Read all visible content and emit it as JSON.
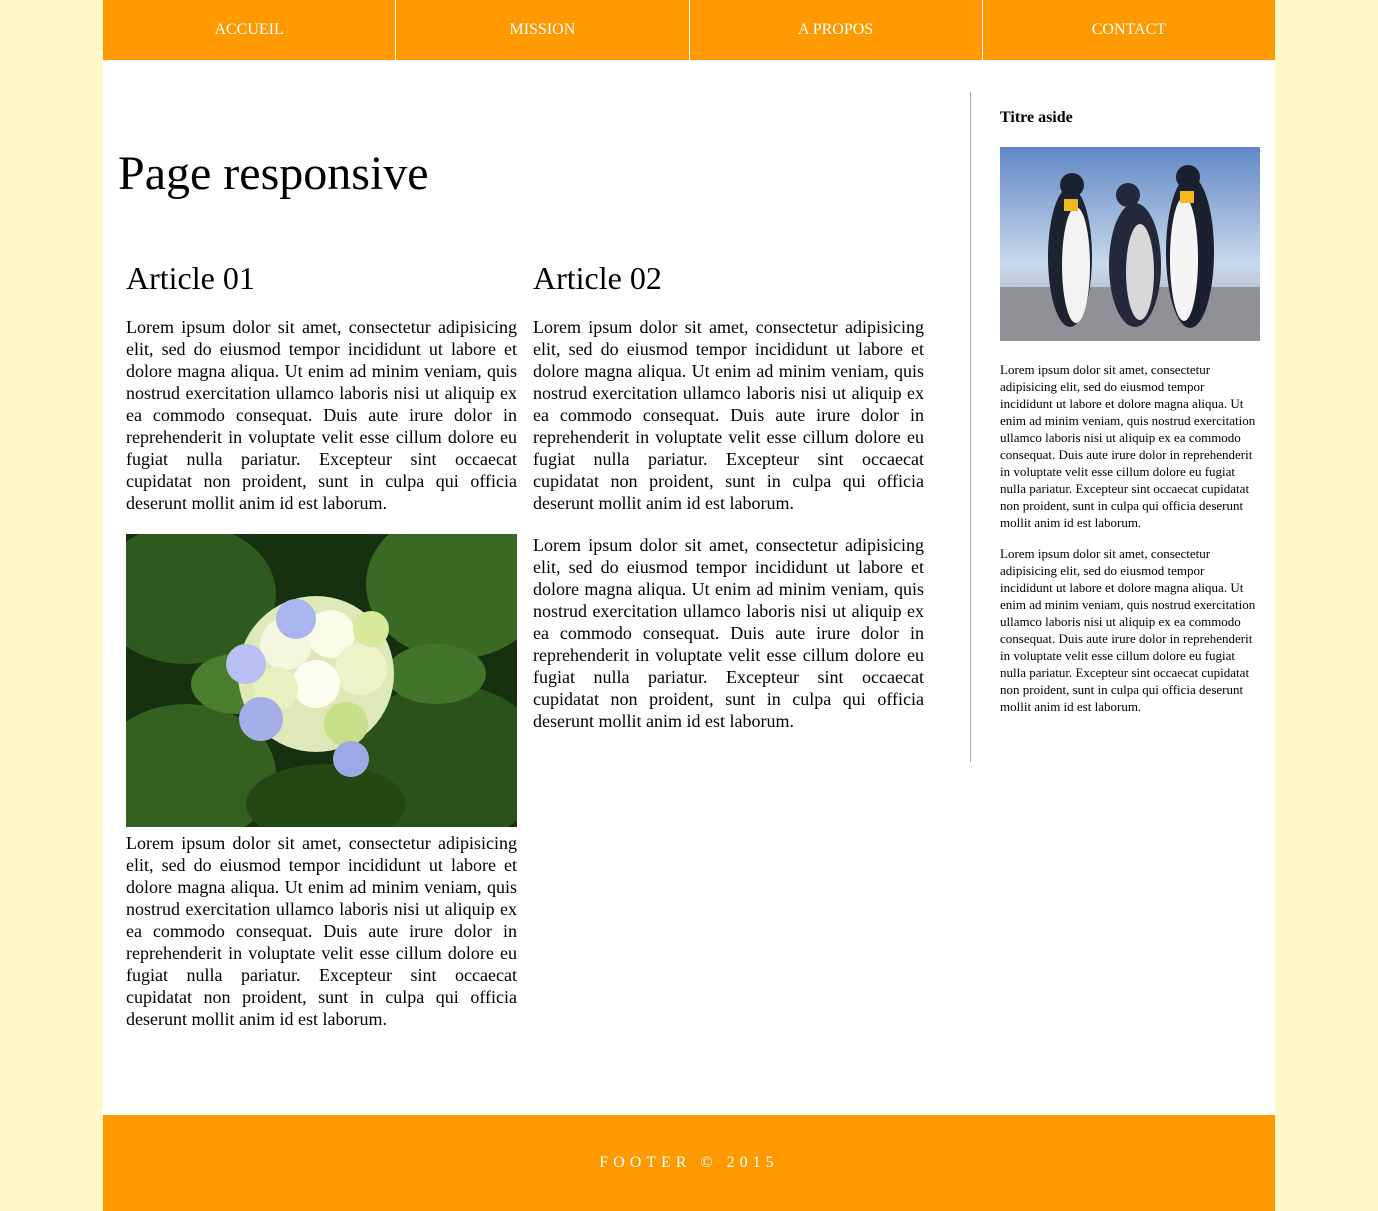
{
  "nav": {
    "items": [
      {
        "label": "ACCUEIL"
      },
      {
        "label": "MISSION"
      },
      {
        "label": "A PROPOS"
      },
      {
        "label": "CONTACT"
      }
    ]
  },
  "main": {
    "title": "Page responsive",
    "articles": [
      {
        "title": "Article 01",
        "paragraphs": [
          "Lorem ipsum dolor sit amet, consectetur adipisicing elit, sed do eiusmod tempor incididunt ut labore et dolore magna aliqua. Ut enim ad minim veniam, quis nostrud exercitation ullamco laboris nisi ut aliquip ex ea commodo consequat. Duis aute irure dolor in reprehenderit in voluptate velit esse cillum dolore eu fugiat nulla pariatur. Excepteur sint occaecat cupidatat non proident, sunt in culpa qui officia deserunt mollit anim id est laborum.",
          "Lorem ipsum dolor sit amet, consectetur adipisicing elit, sed do eiusmod tempor incididunt ut labore et dolore magna aliqua. Ut enim ad minim veniam, quis nostrud exercitation ullamco laboris nisi ut aliquip ex ea commodo consequat. Duis aute irure dolor in reprehenderit in voluptate velit esse cillum dolore eu fugiat nulla pariatur. Excepteur sint occaecat cupidatat non proident, sunt in culpa qui officia deserunt mollit anim id est laborum."
        ]
      },
      {
        "title": "Article 02",
        "paragraphs": [
          "Lorem ipsum dolor sit amet, consectetur adipisicing elit, sed do eiusmod tempor incididunt ut labore et dolore magna aliqua. Ut enim ad minim veniam, quis nostrud exercitation ullamco laboris nisi ut aliquip ex ea commodo consequat. Duis aute irure dolor in reprehenderit in voluptate velit esse cillum dolore eu fugiat nulla pariatur. Excepteur sint occaecat cupidatat non proident, sunt in culpa qui officia deserunt mollit anim id est laborum.",
          "Lorem ipsum dolor sit amet, consectetur adipisicing elit, sed do eiusmod tempor incididunt ut labore et dolore magna aliqua. Ut enim ad minim veniam, quis nostrud exercitation ullamco laboris nisi ut aliquip ex ea commodo consequat. Duis aute irure dolor in reprehenderit in voluptate velit esse cillum dolore eu fugiat nulla pariatur. Excepteur sint occaecat cupidatat non proident, sunt in culpa qui officia deserunt mollit anim id est laborum."
        ]
      }
    ]
  },
  "aside": {
    "title": "Titre aside",
    "paragraphs": [
      "Lorem ipsum dolor sit amet, consectetur adipisicing elit, sed do eiusmod tempor incididunt ut labore et dolore magna aliqua. Ut enim ad minim veniam, quis nostrud exercitation ullamco laboris nisi ut aliquip ex ea commodo consequat. Duis aute irure dolor in reprehenderit in voluptate velit esse cillum dolore eu fugiat nulla pariatur. Excepteur sint occaecat cupidatat non proident, sunt in culpa qui officia deserunt mollit anim id est laborum.",
      "Lorem ipsum dolor sit amet, consectetur adipisicing elit, sed do eiusmod tempor incididunt ut labore et dolore magna aliqua. Ut enim ad minim veniam, quis nostrud exercitation ullamco laboris nisi ut aliquip ex ea commodo consequat. Duis aute irure dolor in reprehenderit in voluptate velit esse cillum dolore eu fugiat nulla pariatur. Excepteur sint occaecat cupidatat non proident, sunt in culpa qui officia deserunt mollit anim id est laborum."
    ]
  },
  "footer": {
    "text": "FOOTER © 2015"
  },
  "colors": {
    "accent": "#ff9900",
    "page_background": "#fff7c7",
    "content_background": "#ffffff"
  }
}
